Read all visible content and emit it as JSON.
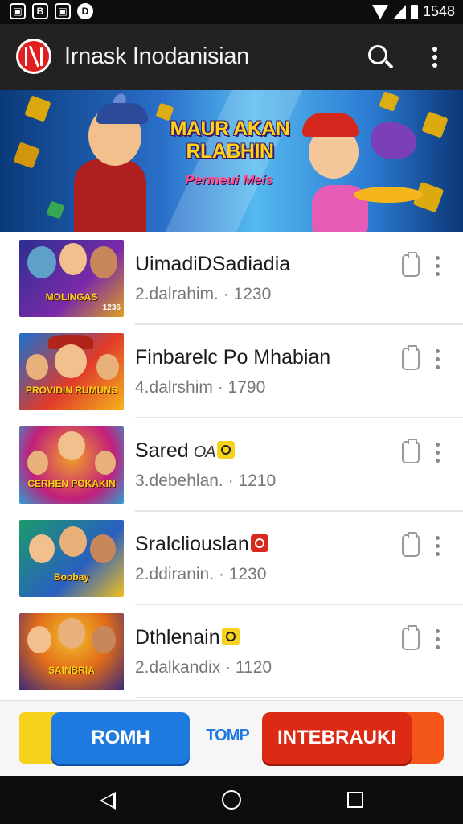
{
  "status_bar": {
    "left_icons": [
      {
        "name": "gallery-icon",
        "glyph": "▣"
      },
      {
        "name": "b-app-icon",
        "glyph": "B"
      },
      {
        "name": "photo-app-icon",
        "glyph": "▣"
      },
      {
        "name": "d-app-icon",
        "glyph": "D"
      }
    ],
    "time": "1548"
  },
  "app_bar": {
    "title": "Irnask Inodanisian"
  },
  "banner": {
    "title": "MAUR AKAN RLABHIN",
    "subtitle": "Permeui Meis"
  },
  "games": [
    {
      "title": "UimadiDSadiadia",
      "meta": "2.dalrahim. · 1230",
      "thumb_label": "MOLINGAS",
      "thumb_count": "1236",
      "colors": [
        "#2a2f8f",
        "#7a2aa8",
        "#e0a020"
      ]
    },
    {
      "title": "Finbarelc Po Mhabian",
      "meta": "4.dalrshim · 1790",
      "thumb_label": "PROVIDIN RUMUNS",
      "thumb_count": "",
      "colors": [
        "#1a6fd0",
        "#e03a2a",
        "#f5b51b"
      ]
    },
    {
      "title": "Sared",
      "badge_text": "OA",
      "meta": "3.debehlan. · 1210",
      "thumb_label": "CERHEN POKAKIN",
      "thumb_count": "",
      "colors": [
        "#c21f7a",
        "#f0a028",
        "#2ea0d0"
      ]
    },
    {
      "title": "Sralcliouslan",
      "meta": "2.ddiranin. · 1230",
      "thumb_label": "Boobay",
      "thumb_count": "",
      "colors": [
        "#1b9a6a",
        "#2a5fc0",
        "#f2c020"
      ]
    },
    {
      "title": "Dthlenain",
      "meta": "2.dalkandix · 1120",
      "thumb_label": "SAINBRIA",
      "thumb_count": "",
      "colors": [
        "#3a2a7a",
        "#e06a1a",
        "#f5c02a"
      ]
    }
  ],
  "actions": {
    "primary_label": "ROMH",
    "middle_label": "TOMP",
    "secondary_label": "INTEBRAUKI"
  },
  "accent_colors": {
    "blue": "#1f7ae0",
    "red": "#dc2a14",
    "yellow": "#f7d21c"
  }
}
